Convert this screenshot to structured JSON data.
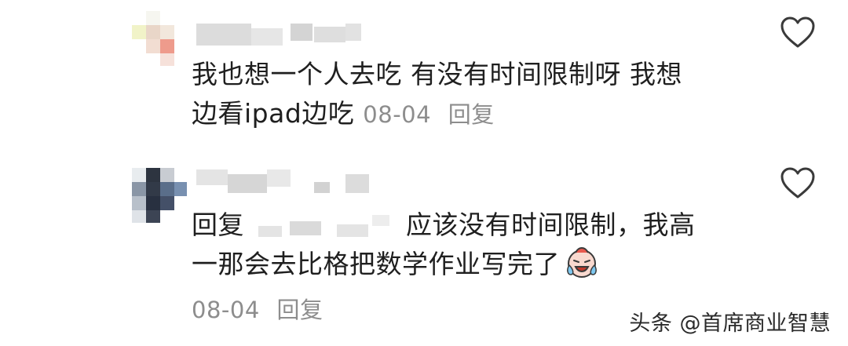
{
  "comments": [
    {
      "text_line1": "我也想一个人去吃 有没有时间限制呀 我想",
      "text_line2": "边看ipad边吃",
      "date": "08-04",
      "reply_label": "回复",
      "like_icon": "heart-outline-icon"
    },
    {
      "reply_prefix": "回复",
      "text_line1": "应该没有时间限制，我高",
      "text_line2": "一那会去比格把数学作业写完了",
      "emoji": "laughing-crying-face-icon",
      "date": "08-04",
      "reply_label": "回复",
      "like_icon": "heart-outline-icon"
    }
  ],
  "watermark": "头条 @首席商业智慧",
  "colors": {
    "text": "#1f1f1f",
    "meta": "#8d8d8d",
    "heart": "#3a3a3a"
  }
}
